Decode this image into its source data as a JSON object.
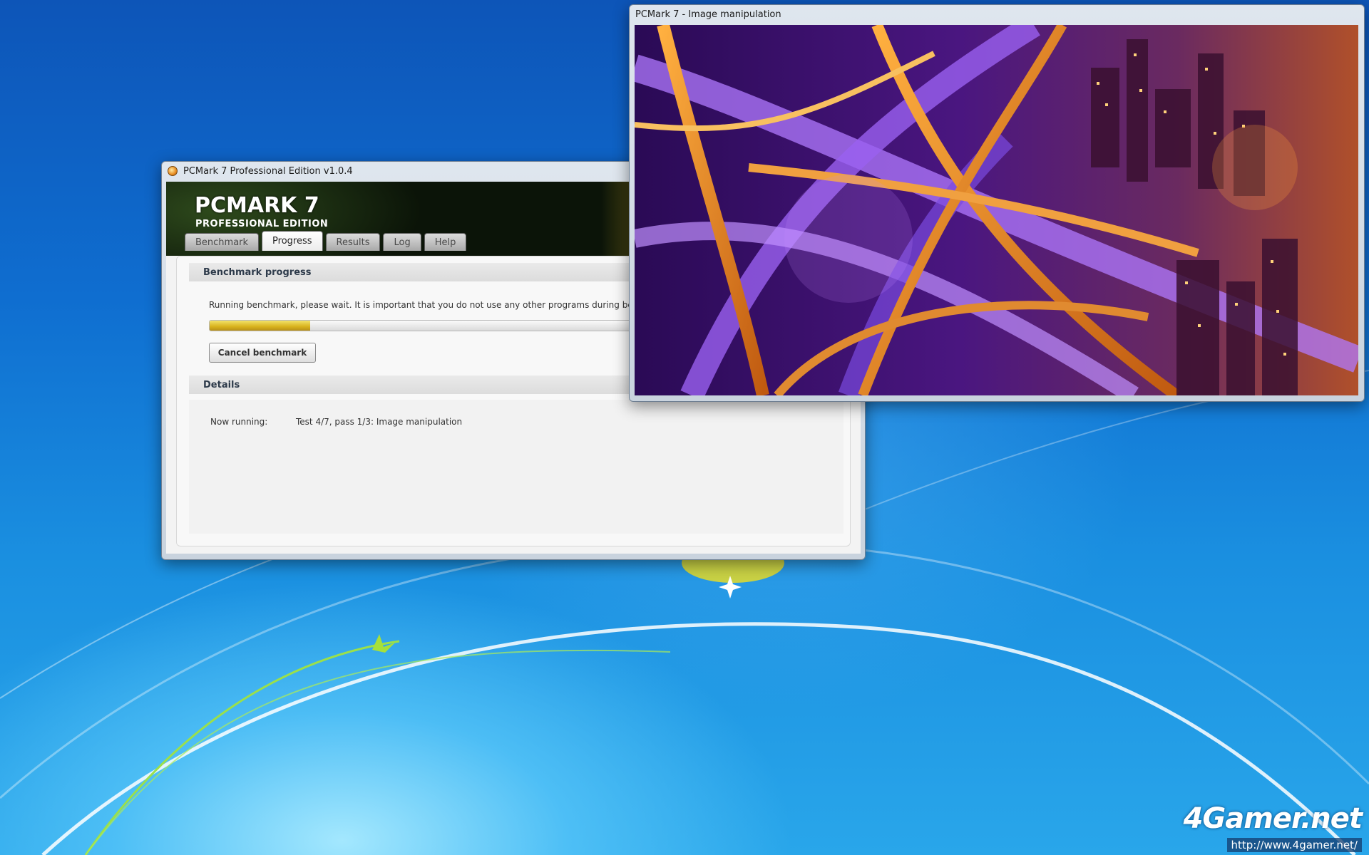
{
  "desktop": {
    "watermark": "4Gamer.net",
    "watermark_url": "http://www.4gamer.net/"
  },
  "main_window": {
    "title": "PCMark 7 Professional Edition v1.0.4",
    "logo_main": "PCMARK 7",
    "logo_sub": "PROFESSIONAL EDITION",
    "tabs": [
      {
        "label": "Benchmark"
      },
      {
        "label": "Progress"
      },
      {
        "label": "Results"
      },
      {
        "label": "Log"
      },
      {
        "label": "Help"
      }
    ],
    "active_tab": "Progress",
    "progress_section": {
      "title": "Benchmark progress",
      "message": "Running benchmark, please wait. It is important that you do not use any other programs during benc",
      "progress_fraction": 0.16,
      "cancel_label": "Cancel benchmark"
    },
    "details_section": {
      "title": "Details",
      "now_running_label": "Now running:",
      "now_running_value": "Test 4/7, pass 1/3: Image manipulation"
    }
  },
  "image_window": {
    "title": "PCMark 7 - Image manipulation"
  },
  "colors": {
    "accent_progress": "#d8b21c",
    "banner_bg": "#0b1408",
    "desktop_blue": "#1a8fe0"
  }
}
